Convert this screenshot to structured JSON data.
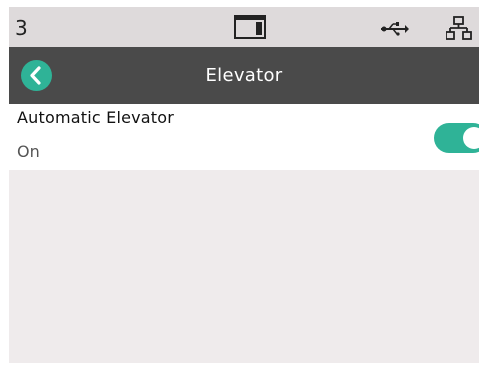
{
  "status_bar": {
    "indicator": "3",
    "icons": [
      "window-icon",
      "usb-icon",
      "network-icon"
    ]
  },
  "header": {
    "title": "Elevator",
    "back_icon": "chevron-left-icon"
  },
  "settings": [
    {
      "label": "Automatic Elevator",
      "value": "On",
      "toggle_on": true
    }
  ],
  "colors": {
    "accent": "#2fb397",
    "header_bg": "#4a4a4a",
    "status_bg": "#dedadb",
    "content_bg": "#efebec"
  }
}
